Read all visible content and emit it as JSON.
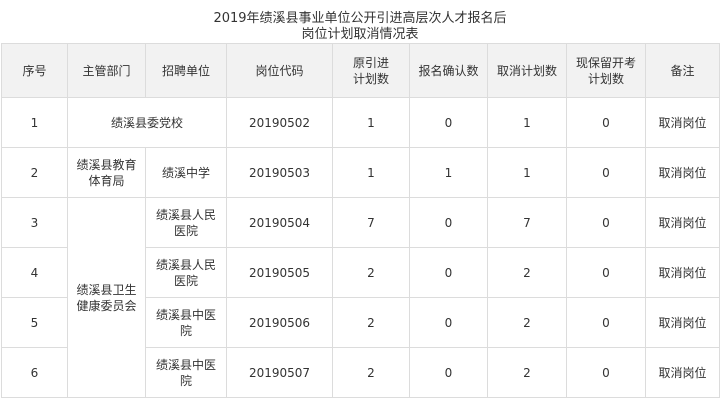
{
  "title": {
    "line1": "2019年绩溪县事业单位公开引进高层次人才报名后",
    "line2": "岗位计划取消情况表"
  },
  "headers": {
    "seq": "序号",
    "dept": "主管部门",
    "unit": "招聘单位",
    "code": "岗位代码",
    "plan": "原引进\n计划数",
    "confirmed": "报名确认数",
    "cancelled": "取消计划数",
    "retained": "现保留开考\n计划数",
    "remark": "备注"
  },
  "rows": [
    {
      "seq": "1",
      "dept_unit": "绩溪县委党校",
      "code": "20190502",
      "plan": "1",
      "confirmed": "0",
      "cancelled": "1",
      "retained": "0",
      "remark": "取消岗位"
    },
    {
      "seq": "2",
      "dept": "绩溪县教育\n体育局",
      "unit": "绩溪中学",
      "code": "20190503",
      "plan": "1",
      "confirmed": "1",
      "cancelled": "1",
      "retained": "0",
      "remark": "取消岗位"
    },
    {
      "seq": "3",
      "dept": "绩溪县卫生\n健康委员会",
      "unit": "绩溪县人民\n医院",
      "code": "20190504",
      "plan": "7",
      "confirmed": "0",
      "cancelled": "7",
      "retained": "0",
      "remark": "取消岗位"
    },
    {
      "seq": "4",
      "unit": "绩溪县人民\n医院",
      "code": "20190505",
      "plan": "2",
      "confirmed": "0",
      "cancelled": "2",
      "retained": "0",
      "remark": "取消岗位"
    },
    {
      "seq": "5",
      "unit": "绩溪县中医\n院",
      "code": "20190506",
      "plan": "2",
      "confirmed": "0",
      "cancelled": "2",
      "retained": "0",
      "remark": "取消岗位"
    },
    {
      "seq": "6",
      "unit": "绩溪县中医\n院",
      "code": "20190507",
      "plan": "2",
      "confirmed": "0",
      "cancelled": "2",
      "retained": "0",
      "remark": "取消岗位"
    }
  ]
}
